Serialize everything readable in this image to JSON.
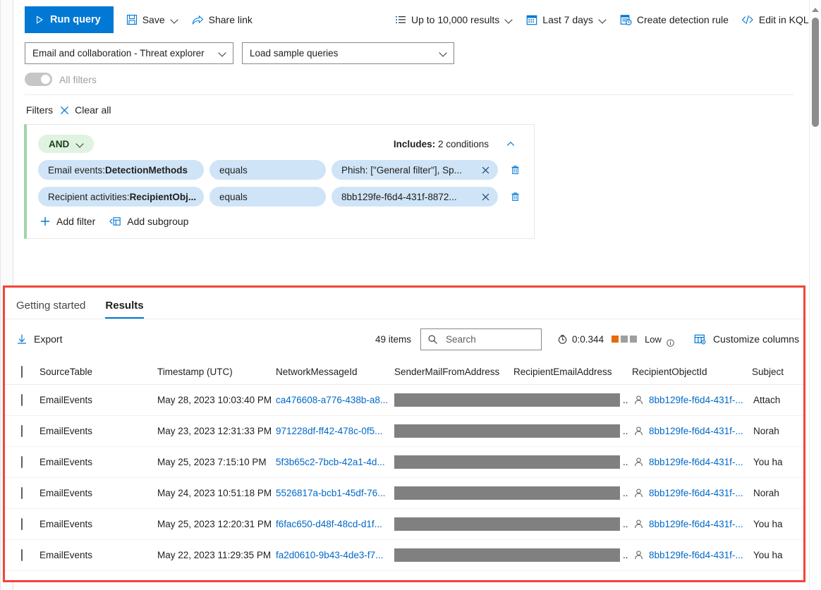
{
  "toolbar": {
    "run_query": "Run query",
    "save": "Save",
    "share_link": "Share link",
    "results_limit": "Up to 10,000 results",
    "time_range": "Last 7 days",
    "create_detection_rule": "Create detection rule",
    "edit_in_kql": "Edit in KQL"
  },
  "selectors": {
    "scenario": "Email and collaboration - Threat explorer",
    "sample_queries": "Load sample queries"
  },
  "all_filters_toggle": {
    "label": "All filters",
    "state": "off"
  },
  "filters": {
    "title": "Filters",
    "clear_all": "Clear all",
    "group": {
      "operator": "AND",
      "includes_label": "Includes:",
      "includes_value": "2 conditions",
      "conditions": [
        {
          "field_prefix": "Email events: ",
          "field_name": "DetectionMethods",
          "operator": "equals",
          "value": "Phish: [\"General filter\"], Sp..."
        },
        {
          "field_prefix": "Recipient activities: ",
          "field_name": "RecipientObj...",
          "operator": "equals",
          "value": "8bb129fe-f6d4-431f-8872..."
        }
      ],
      "add_filter": "Add filter",
      "add_subgroup": "Add subgroup"
    }
  },
  "results_panel": {
    "tabs": [
      {
        "label": "Getting started",
        "active": false
      },
      {
        "label": "Results",
        "active": true
      }
    ],
    "export": "Export",
    "items_count": "49 items",
    "search_placeholder": "Search",
    "search_value": "",
    "perf_time": "0:0.344",
    "perf_level": "Low",
    "customize_columns": "Customize columns",
    "table": {
      "columns": [
        "SourceTable",
        "Timestamp (UTC)",
        "NetworkMessageId",
        "SenderMailFromAddress",
        "RecipientEmailAddress",
        "RecipientObjectId",
        "Subject"
      ],
      "rows": [
        {
          "source_table": "EmailEvents",
          "timestamp": "May 28, 2023 10:03:40 PM",
          "network_message_id": "ca476608-a776-438b-a8...",
          "sender_mail_from_address": "",
          "recipient_email_address": "",
          "redacted_suffix": "..",
          "recipient_object_id": "8bb129fe-f6d4-431f-...",
          "subject": "Attach"
        },
        {
          "source_table": "EmailEvents",
          "timestamp": "May 23, 2023 12:31:33 PM",
          "network_message_id": "971228df-ff42-478c-0f5...",
          "sender_mail_from_address": "",
          "recipient_email_address": "",
          "redacted_suffix": "..",
          "recipient_object_id": "8bb129fe-f6d4-431f-...",
          "subject": "Norah"
        },
        {
          "source_table": "EmailEvents",
          "timestamp": "May 25, 2023 7:15:10 PM",
          "network_message_id": "5f3b65c2-7bcb-42a1-4d...",
          "sender_mail_from_address": "",
          "recipient_email_address": "",
          "redacted_suffix": "..",
          "recipient_object_id": "8bb129fe-f6d4-431f-...",
          "subject": "You ha"
        },
        {
          "source_table": "EmailEvents",
          "timestamp": "May 24, 2023 10:51:18 PM",
          "network_message_id": "5526817a-bcb1-45df-76...",
          "sender_mail_from_address": "",
          "recipient_email_address": "",
          "redacted_suffix": "..",
          "recipient_object_id": "8bb129fe-f6d4-431f-...",
          "subject": "Norah"
        },
        {
          "source_table": "EmailEvents",
          "timestamp": "May 25, 2023 12:20:31 PM",
          "network_message_id": "f6fac650-d48f-48cd-d1f...",
          "sender_mail_from_address": "",
          "recipient_email_address": "",
          "redacted_suffix": "..",
          "recipient_object_id": "8bb129fe-f6d4-431f-...",
          "subject": "You ha"
        },
        {
          "source_table": "EmailEvents",
          "timestamp": "May 22, 2023 11:29:35 PM",
          "network_message_id": "fa2d0610-9b43-4de3-f7...",
          "sender_mail_from_address": "",
          "recipient_email_address": "",
          "redacted_suffix": "..",
          "recipient_object_id": "8bb129fe-f6d4-431f-...",
          "subject": "You ha"
        }
      ]
    }
  },
  "colors": {
    "accent": "#0078d4",
    "link": "#0068c9",
    "annotation": "#f2443a",
    "pill_blue": "#cfe4f7",
    "pill_green": "#dff3e0",
    "group_border_green": "#a0d5a8",
    "perf_orange": "#e8690b",
    "perf_gray": "#a19f9d",
    "redaction": "#808080"
  }
}
